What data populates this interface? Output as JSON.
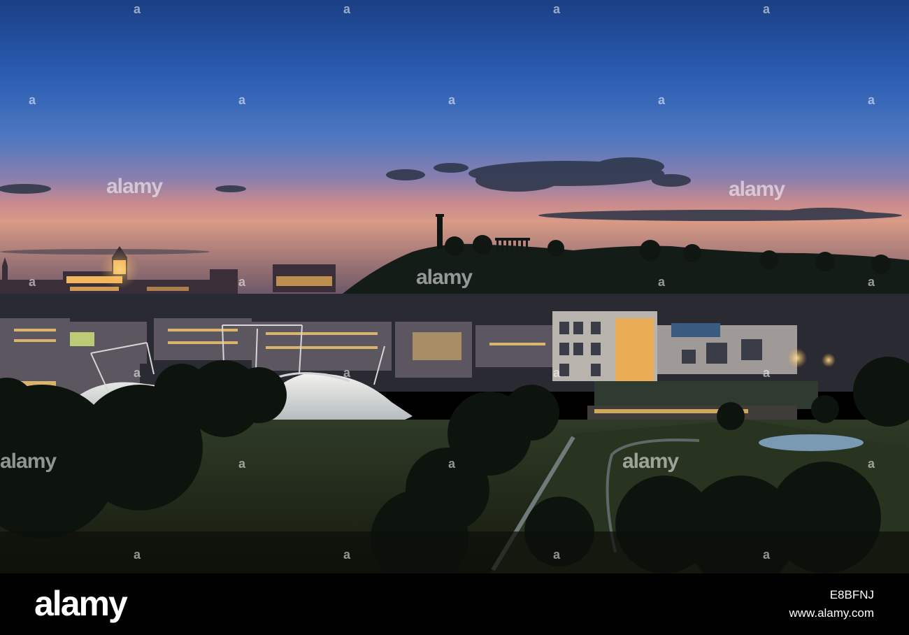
{
  "watermark": {
    "brand": "alamy",
    "small_mark": "a"
  },
  "footer": {
    "logo": "alamy",
    "image_id": "E8BFNJ",
    "site": "www.alamy.com"
  }
}
